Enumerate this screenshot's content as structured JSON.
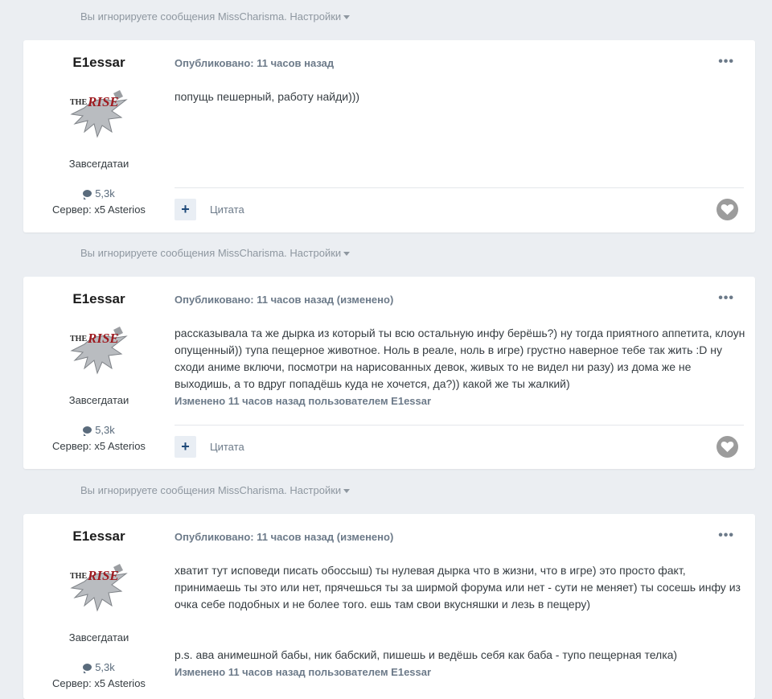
{
  "ignored": {
    "text": "Вы игнорируете сообщения MissCharisma.",
    "settings": "Настройки"
  },
  "posts": [
    {
      "author": "E1essar",
      "avatar_text_1": "THE",
      "avatar_text_2": "RISE",
      "group": "Завсегдатаи",
      "count": "5,3k",
      "server": "Сервер: x5 Asterios",
      "meta": "Опубликовано: 11 часов назад",
      "edited": "",
      "paragraphs": [
        "попущь пешерный, работу найди)))"
      ],
      "edit_note": "",
      "quote": "Цитата"
    },
    {
      "author": "E1essar",
      "avatar_text_1": "THE",
      "avatar_text_2": "RISE",
      "group": "Завсегдатаи",
      "count": "5,3k",
      "server": "Сервер: x5 Asterios",
      "meta": "Опубликовано: 11 часов назад",
      "edited": "(изменено)",
      "paragraphs": [
        "рассказывала та же дырка из который ты всю остальную инфу берёшь?) ну тогда приятного аппетита, клоун опущенный)) тупа пещерное животное. Ноль в реале, ноль в игре) грустно наверное тебе так жить :D ну сходи аниме включи, посмотри на нарисованных девок, живых то не видел ни разу) из дома же не выходишь, а то вдруг попадёшь куда не хочется, да?)) какой же ты жалкий)"
      ],
      "edit_note": "Изменено 11 часов назад пользователем E1essar",
      "quote": "Цитата"
    },
    {
      "author": "E1essar",
      "avatar_text_1": "THE",
      "avatar_text_2": "RISE",
      "group": "Завсегдатаи",
      "count": "5,3k",
      "server": "Сервер: x5 Asterios",
      "meta": "Опубликовано: 11 часов назад",
      "edited": "(изменено)",
      "paragraphs": [
        "хватит тут исповеди писать обоссыш) ты нулевая дырка что в жизни, что в игре) это просто факт, принимаешь ты это или нет, прячешься ты за ширмой форума или нет - сути не меняет) ты сосешь инфу из очка себе подобных и не более того. ешь там свои вкусняшки и лезь в пещеру)",
        "p.s. ава анимешной бабы, ник бабский, пишешь и ведёшь себя как баба - тупо пещерная телка)"
      ],
      "edit_note": "Изменено 11 часов назад пользователем E1essar",
      "quote": "Цитата"
    }
  ]
}
